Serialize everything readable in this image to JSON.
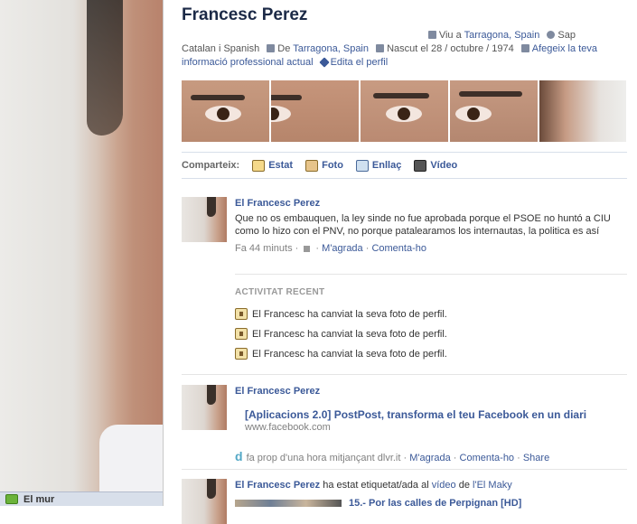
{
  "profile": {
    "name": "Francesc Perez",
    "info_line1_prefix": "Viu a",
    "info_lives": "Tarragona, Spain",
    "info_sap": "Sap",
    "info_languages": "Catalan i Spanish",
    "info_from_prefix": "De",
    "info_from": "Tarragona, Spain",
    "info_born": "Nascut el 28 / octubre / 1974",
    "info_work_link": "Afegeix la teva informació professional actual",
    "edit_profile": "Edita el perfil"
  },
  "share": {
    "label": "Comparteix:",
    "status": "Estat",
    "photo": "Foto",
    "link": "Enllaç",
    "video": "Vídeo"
  },
  "posts": [
    {
      "author": "El Francesc Perez",
      "text": "Que no os embauquen, la ley sinde no fue aprobada porque el PSOE no huntó a CIU como lo hizo con el PNV, no porque patalearamos los internautas, la politica es así",
      "time": "Fa 44 minuts",
      "like": "M'agrada",
      "comment": "Comenta-ho"
    },
    {
      "author": "El Francesc Perez",
      "link_title": "[Aplicacions 2.0] PostPost, transforma el teu Facebook en un diari",
      "link_domain": "www.facebook.com",
      "time": "fa prop d'una hora mitjançant dlvr.it",
      "like": "M'agrada",
      "comment": "Comenta-ho",
      "share": "Share"
    },
    {
      "author": "El Francesc Perez",
      "text_mid": "ha estat etiquetat/ada al",
      "video_word": "vídeo",
      "text_de": "de",
      "tagged_by": "l'El Maky",
      "video_title": "15.- Por las calles de Perpignan [HD]"
    }
  ],
  "recent": {
    "title": "ACTIVITAT RECENT",
    "items": [
      "El Francesc ha canviat la seva foto de perfil.",
      "El Francesc ha canviat la seva foto de perfil.",
      "El Francesc ha canviat la seva foto de perfil."
    ]
  },
  "sidebar": {
    "wall": "El mur"
  }
}
